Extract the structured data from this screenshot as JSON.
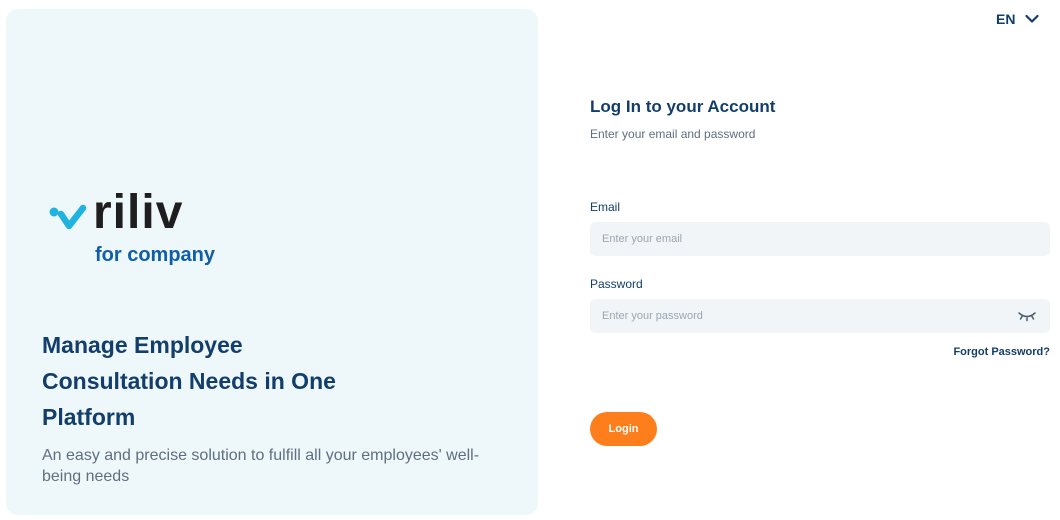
{
  "brand": {
    "name": "riliv",
    "subtitle": "for company",
    "check_color": "#20b3e0",
    "subtitle_color": "#0f5ea8"
  },
  "hero": {
    "headline": "Manage Employee Consultation Needs in One Platform",
    "description": "An easy and precise solution to fulfill all your employees' well-being needs"
  },
  "language": {
    "selected": "EN",
    "icon": "chevron-down-icon"
  },
  "login": {
    "title": "Log In to your Account",
    "subtitle": "Enter your email and password",
    "email_label": "Email",
    "email_placeholder": "Enter your email",
    "password_label": "Password",
    "password_placeholder": "Enter your password",
    "password_toggle_icon": "eye-closed-icon",
    "forgot_label": "Forgot Password?",
    "submit_label": "Login",
    "accent_color": "#ff7e1c"
  }
}
